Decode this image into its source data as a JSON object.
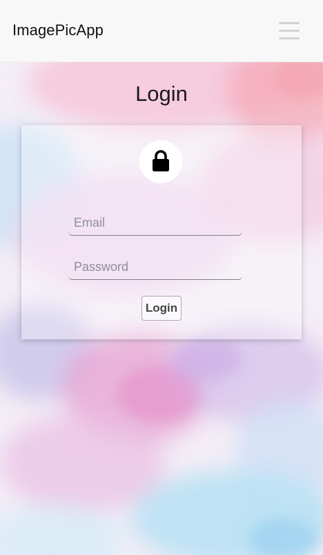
{
  "app": {
    "brand": "ImagePicApp",
    "menu_icon": "hamburger-menu-icon"
  },
  "page": {
    "title": "Login"
  },
  "login_form": {
    "avatar_icon": "lock-icon",
    "email": {
      "value": "",
      "placeholder": "Email"
    },
    "password": {
      "value": "",
      "placeholder": "Password"
    },
    "submit_label": "Login"
  },
  "colors": {
    "navbar_bg": "#f8f8f8",
    "brand_text": "#111111",
    "menu_icon": "#d2d2d2",
    "watercolor_pink": "#efa6cf",
    "watercolor_blue": "#a9dcf3",
    "watercolor_lavender": "#cdb7e6",
    "button_text": "#444444"
  }
}
